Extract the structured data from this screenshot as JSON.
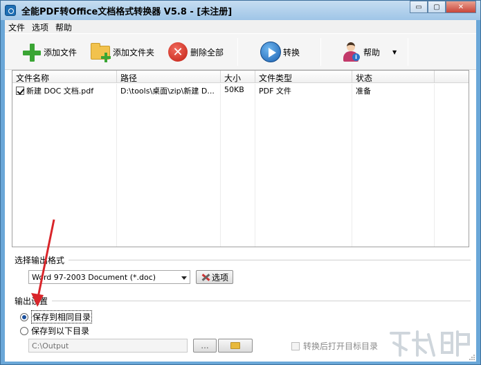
{
  "window": {
    "title": "全能PDF转Office文档格式转换器 V5.8  -  [未注册]",
    "controls": {
      "minimize": "▭",
      "maximize": "▢",
      "close": "✕"
    }
  },
  "menu": {
    "items": [
      "文件",
      "选项",
      "帮助"
    ]
  },
  "toolbar": {
    "add_file": "添加文件",
    "add_folder": "添加文件夹",
    "delete_all": "删除全部",
    "convert": "转换",
    "help": "帮助",
    "help_dropdown": "▼"
  },
  "file_list": {
    "columns": [
      "文件名称",
      "路径",
      "大小",
      "文件类型",
      "状态"
    ],
    "rows": [
      {
        "checked": true,
        "name": "新建 DOC 文档.pdf",
        "path": "D:\\tools\\桌面\\zip\\新建 D...",
        "size": "50KB",
        "type": "PDF 文件",
        "status": "准备"
      }
    ]
  },
  "output_format": {
    "group_label": "选择输出格式",
    "selected": "Word 97-2003 Document (*.doc)",
    "options_button": "选项"
  },
  "output_settings": {
    "group_label": "输出设置",
    "radio_same_dir": "保存到相同目录",
    "radio_custom_dir": "保存到以下目录",
    "selected": "same_dir",
    "path_value": "C:\\Output",
    "browse_button": "...",
    "open_after_label": "转换后打开目标目录",
    "open_after_checked": false
  },
  "watermark": {
    "text": "下载吧"
  },
  "colors": {
    "title_bar": "#9fc5e7",
    "annotation_arrow": "#d9252a"
  }
}
